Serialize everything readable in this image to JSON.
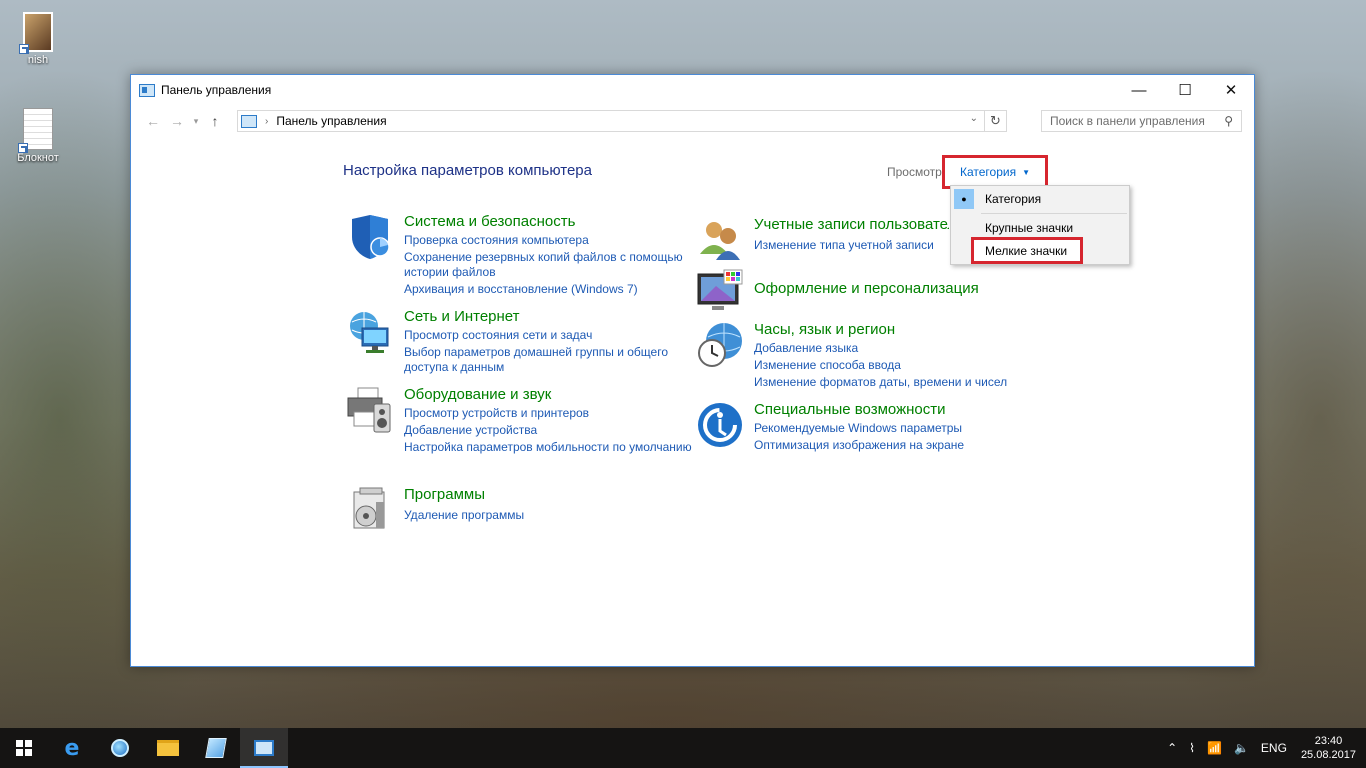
{
  "desktop": {
    "icons": [
      {
        "label": "nish"
      },
      {
        "label": "Блокнот"
      }
    ]
  },
  "window": {
    "title": "Панель управления",
    "controls": {
      "minimize": "—",
      "maximize": "☐",
      "close": "✕"
    }
  },
  "address": {
    "breadcrumb": "Панель управления",
    "search_placeholder": "Поиск в панели управления"
  },
  "main": {
    "title": "Настройка параметров компьютера",
    "view_label": "Просмотр",
    "view_value": "Категория"
  },
  "view_menu": {
    "items": [
      {
        "label": "Категория",
        "selected": true
      },
      {
        "label": "Крупные значки"
      },
      {
        "label": "Мелкие значки"
      }
    ]
  },
  "categories": {
    "left": [
      {
        "title": "Система и безопасность",
        "icon": "shield-icon",
        "links": [
          "Проверка состояния компьютера",
          "Сохранение резервных копий файлов с помощью истории файлов",
          "Архивация и восстановление (Windows 7)"
        ]
      },
      {
        "title": "Сеть и Интернет",
        "icon": "network-globe-icon",
        "links": [
          "Просмотр состояния сети и задач",
          "Выбор параметров домашней группы и общего доступа к данным"
        ]
      },
      {
        "title": "Оборудование и звук",
        "icon": "printer-speaker-icon",
        "links": [
          "Просмотр устройств и принтеров",
          "Добавление устройства",
          "Настройка параметров мобильности по умолчанию"
        ]
      },
      {
        "title": "Программы",
        "icon": "programs-icon",
        "links": [
          "Удаление программы"
        ]
      }
    ],
    "right": [
      {
        "title": "Учетные записи пользователей",
        "icon": "users-icon",
        "links": [
          "Изменение типа учетной записи"
        ]
      },
      {
        "title": "Оформление и персонализация",
        "icon": "monitor-palette-icon",
        "links": []
      },
      {
        "title": "Часы, язык и регион",
        "icon": "clock-globe-icon",
        "links": [
          "Добавление языка",
          "Изменение способа ввода",
          "Изменение форматов даты, времени и чисел"
        ]
      },
      {
        "title": "Специальные возможности",
        "icon": "accessibility-icon",
        "links": [
          "Рекомендуемые Windows параметры",
          "Оптимизация изображения на экране"
        ]
      }
    ]
  },
  "taskbar": {
    "language": "ENG",
    "time": "23:40",
    "date": "25.08.2017"
  },
  "colors": {
    "accent_red": "#d6262f",
    "link_blue": "#1e5ab4",
    "category_green": "#008000",
    "title_blue": "#1e3287"
  }
}
